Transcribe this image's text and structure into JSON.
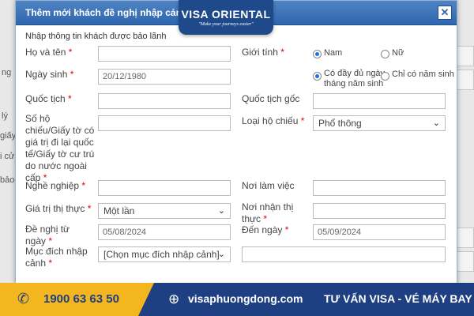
{
  "dialog": {
    "title": "Thêm mới khách đề nghị nhập cảnh",
    "close_label": "✕",
    "section_title": "Nhập thông tin khách được bảo lãnh"
  },
  "logo": {
    "name": "VISA ORIENTAL",
    "tagline": "\"Make your journeys easier\""
  },
  "background_fragments": [
    "ng",
    "lý",
    "giấy",
    "i cửa",
    "bảo"
  ],
  "form": {
    "full_name": {
      "label": "Họ và tên",
      "value": ""
    },
    "gender": {
      "label": "Giới tính",
      "options": [
        "Nam",
        "Nữ"
      ],
      "selected": "Nam"
    },
    "dob": {
      "label": "Ngày sinh",
      "value": "20/12/1980"
    },
    "dob_mode": {
      "options": [
        "Có đầy đủ ngày tháng năm sinh",
        "Chỉ có năm sinh"
      ],
      "selected": "Có đầy đủ ngày tháng năm sinh"
    },
    "nationality": {
      "label": "Quốc tịch",
      "value": ""
    },
    "original_nationality": {
      "label": "Quốc tịch gốc",
      "value": ""
    },
    "passport_no": {
      "label": "Số hộ chiếu/Giấy tờ có giá trị đi lại quốc tế/Giấy tờ cư trú do nước ngoài cấp",
      "value": ""
    },
    "passport_type": {
      "label": "Loại hộ chiếu",
      "value": "Phổ thông"
    },
    "occupation": {
      "label": "Nghề nghiệp",
      "value": ""
    },
    "workplace": {
      "label": "Nơi làm việc",
      "value": ""
    },
    "visa_validity": {
      "label": "Giá trị thị thực",
      "value": "Một lần"
    },
    "visa_place": {
      "label": "Nơi nhận thị thực",
      "value": ""
    },
    "from_date": {
      "label": "Đề nghị từ ngày",
      "value": "05/08/2024"
    },
    "to_date": {
      "label": "Đến ngày",
      "value": "05/09/2024"
    },
    "purpose": {
      "label": "Mục đích nhập cảnh",
      "value": "[Chọn mục đích nhập cảnh]"
    },
    "purpose_other": {
      "value": ""
    },
    "required_mark": "*"
  },
  "banner": {
    "phone": "1900 63 63 50",
    "website": "visaphuongdong.com",
    "slogan": "TƯ VẤN VISA - VÉ MÁY BAY",
    "phone_icon": "phone-icon",
    "globe_icon": "globe-icon"
  }
}
